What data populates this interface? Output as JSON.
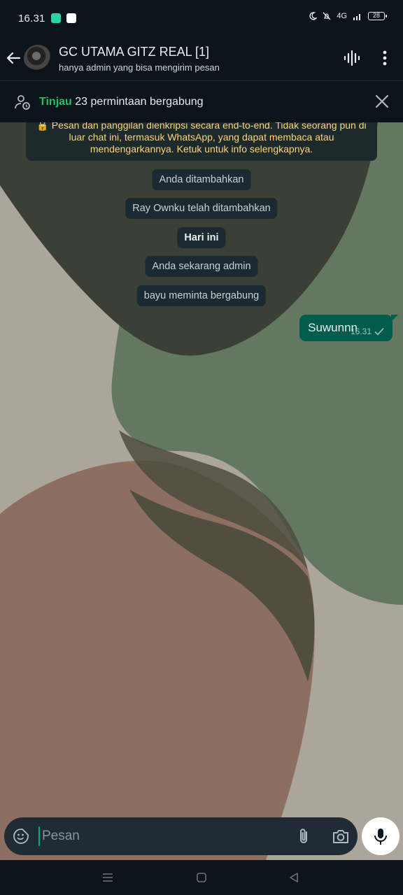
{
  "status_bar": {
    "time": "16.31",
    "network": "4G",
    "battery": "28"
  },
  "header": {
    "title": "GC UTAMA GITZ REAL [1]",
    "subtitle": "hanya admin yang bisa mengirim pesan"
  },
  "banner": {
    "review_label": "Tinjau",
    "request_text": "23 permintaan bergabung"
  },
  "chat": {
    "encryption_notice": "🔒 Pesan dan panggilan dienkripsi secara end-to-end. Tidak seorang pun di luar chat ini, termasuk WhatsApp, yang dapat membaca atau mendengarkannya. Ketuk untuk info selengkapnya.",
    "system_messages": [
      "Anda ditambahkan",
      "Ray Ownku telah ditambahkan",
      "Hari ini",
      "Anda sekarang admin",
      "bayu meminta bergabung"
    ],
    "outgoing": {
      "text": "Suwunnn",
      "time": "16.31"
    }
  },
  "input": {
    "placeholder": "Pesan"
  },
  "colors": {
    "accent": "#21c063",
    "outgoing_bubble": "#005c4b",
    "background": "#0b141a",
    "notice_text": "#ffd279"
  },
  "icons": [
    "back-arrow-icon",
    "voice-chat-icon",
    "more-vert-icon",
    "person-clock-icon",
    "close-icon",
    "emoji-icon",
    "attach-icon",
    "camera-icon",
    "mic-icon",
    "checkmark-icon"
  ]
}
